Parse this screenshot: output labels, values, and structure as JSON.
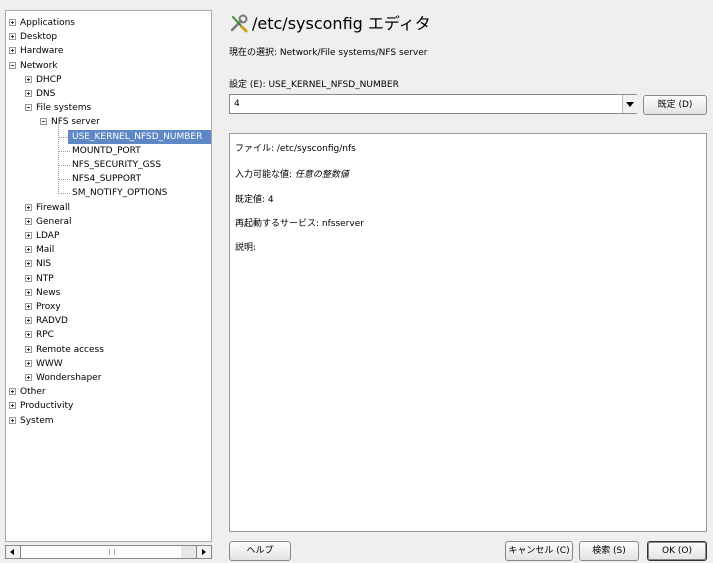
{
  "window": {
    "title": "/etc/sysconfig エディタ",
    "icon": "wrench-screwdriver-icon"
  },
  "tree": {
    "items": [
      {
        "label": "Applications",
        "toggle": "plus"
      },
      {
        "label": "Desktop",
        "toggle": "plus"
      },
      {
        "label": "Hardware",
        "toggle": "plus"
      },
      {
        "label": "Network",
        "toggle": "minus"
      },
      {
        "label": "DHCP",
        "toggle": "plus"
      },
      {
        "label": "DNS",
        "toggle": "plus"
      },
      {
        "label": "File systems",
        "toggle": "minus"
      },
      {
        "label": "NFS server",
        "toggle": "minus"
      },
      {
        "label": "USE_KERNEL_NFSD_NUMBER",
        "selected": true
      },
      {
        "label": "MOUNTD_PORT"
      },
      {
        "label": "NFS_SECURITY_GSS"
      },
      {
        "label": "NFS4_SUPPORT"
      },
      {
        "label": "SM_NOTIFY_OPTIONS"
      },
      {
        "label": "Firewall",
        "toggle": "plus"
      },
      {
        "label": "General",
        "toggle": "plus"
      },
      {
        "label": "LDAP",
        "toggle": "plus"
      },
      {
        "label": "Mail",
        "toggle": "plus"
      },
      {
        "label": "NIS",
        "toggle": "plus"
      },
      {
        "label": "NTP",
        "toggle": "plus"
      },
      {
        "label": "News",
        "toggle": "plus"
      },
      {
        "label": "Proxy",
        "toggle": "plus"
      },
      {
        "label": "RADVD",
        "toggle": "plus"
      },
      {
        "label": "RPC",
        "toggle": "plus"
      },
      {
        "label": "Remote access",
        "toggle": "plus"
      },
      {
        "label": "WWW",
        "toggle": "plus"
      },
      {
        "label": "Wondershaper",
        "toggle": "plus"
      },
      {
        "label": "Other",
        "toggle": "plus"
      },
      {
        "label": "Productivity",
        "toggle": "plus"
      },
      {
        "label": "System",
        "toggle": "plus"
      }
    ]
  },
  "current_selection": "現在の選択: Network/File systems/NFS server",
  "setting": {
    "label": "設定 (E): USE_KERNEL_NFSD_NUMBER",
    "value": "4",
    "default_button": "既定 (D)"
  },
  "info": {
    "file_line": "ファイル: /etc/sysconfig/nfs",
    "possible_label": "入力可能な値: ",
    "possible_value": "任意の整数値",
    "default_line": "既定値: 4",
    "service_line": "再起動するサービス: nfsserver",
    "description_line": "説明:"
  },
  "buttons": {
    "help": "ヘルプ",
    "cancel": "キャンセル (C)",
    "search": "検索 (S)",
    "ok": "OK (O)"
  },
  "colors": {
    "selection": "#5d87c5",
    "background": "#efefef"
  }
}
